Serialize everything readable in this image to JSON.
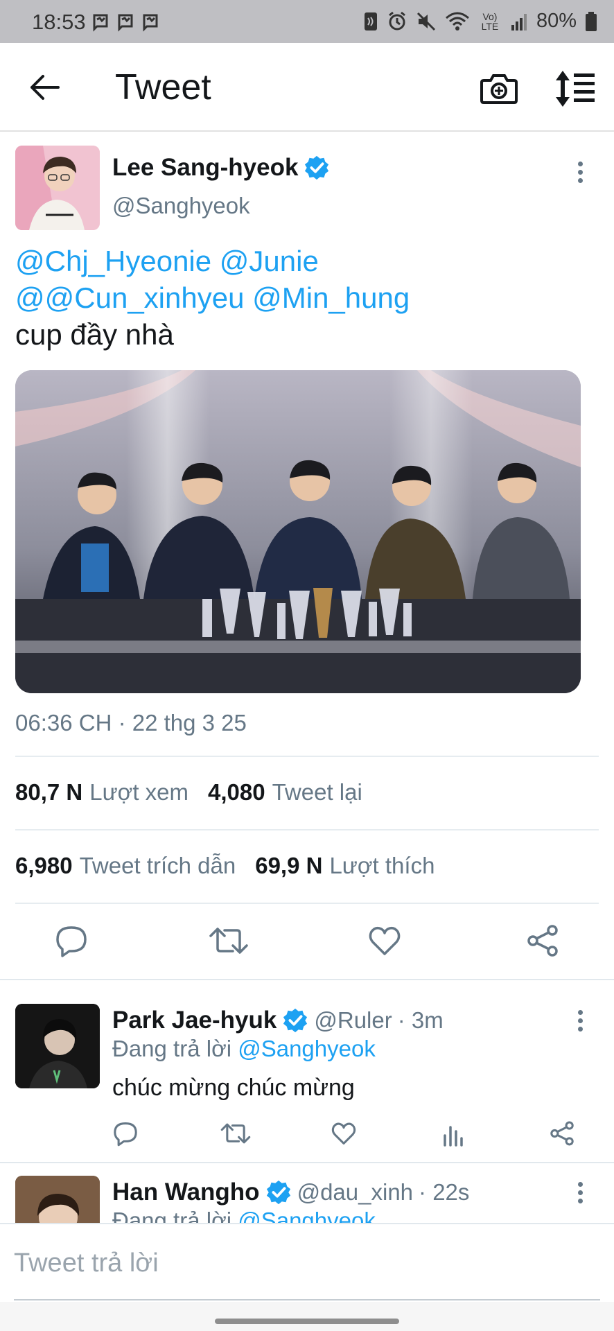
{
  "status_bar": {
    "time": "18:53",
    "left_icons": [
      "messenger-icon",
      "messenger-icon",
      "messenger-icon"
    ],
    "right_icons": [
      "nfc-icon",
      "alarm-icon",
      "mute-icon",
      "wifi-icon",
      "volte-icon",
      "signal-icon"
    ],
    "volte_label": "Vo) LTE",
    "battery": "80%"
  },
  "app_bar": {
    "title": "Tweet"
  },
  "tweet": {
    "author_name": "Lee Sang-hyeok",
    "author_handle": "@Sanghyeok",
    "verified": true,
    "line1_mention_a": "@Chj_Hyeonie",
    "line1_mention_b": "@Junie",
    "line2_mention_a": "@@Cun_xinhyeu",
    "line2_mention_b": "@Min_hung",
    "line3_text": "cup đầy nhà",
    "timestamp": "06:36 CH · 22 thg 3 25",
    "stats": {
      "views_value": "80,7 N",
      "views_label": "Lượt xem",
      "retweets_value": "4,080",
      "retweets_label": "Tweet lại",
      "quotes_value": "6,980",
      "quotes_label": "Tweet trích dẫn",
      "likes_value": "69,9 N",
      "likes_label": "Lượt thích"
    }
  },
  "replies": [
    {
      "name": "Park Jae-hyuk",
      "handle": "@Ruler",
      "time": "· 3m",
      "replying_prefix": "Đang trả lời",
      "replying_to": "@Sanghyeok",
      "text": "chúc mừng chúc mừng"
    },
    {
      "name": "Han Wangho",
      "handle": "@dau_xinh",
      "time": "· 22s",
      "replying_prefix": "Đang trả lời",
      "replying_to": "@Sanghyeok",
      "text": ""
    }
  ],
  "composer": {
    "placeholder": "Tweet trả lời",
    "value": ""
  },
  "colors": {
    "accent": "#1da1f2",
    "secondary_text": "#657786",
    "primary_text": "#14171a",
    "status_bar_bg": "#bfbfc3"
  }
}
